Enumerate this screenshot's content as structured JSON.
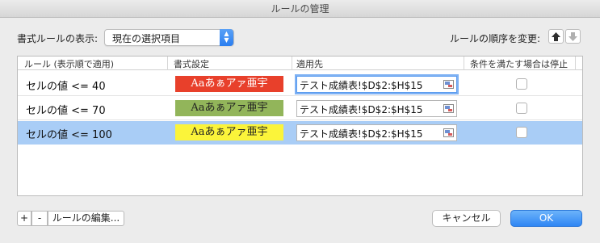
{
  "window": {
    "title": "ルールの管理"
  },
  "display": {
    "label": "書式ルールの表示:",
    "selected": "現在の選択項目"
  },
  "order": {
    "label": "ルールの順序を変更:"
  },
  "table": {
    "headers": [
      "ルール (表示順で適用)",
      "書式設定",
      "適用先",
      "条件を満たす場合は停止"
    ],
    "rows": [
      {
        "condition": "セルの値 <= 40",
        "preview": "Aaあぁアァ亜宇",
        "preview_bg": "#e8402b",
        "preview_fg": "#ffffff",
        "applies_to": "テスト成績表!$D$2:$H$15",
        "stop": false
      },
      {
        "condition": "セルの値 <= 70",
        "preview": "Aaあぁアァ亜宇",
        "preview_bg": "#92b55a",
        "preview_fg": "#222222",
        "applies_to": "テスト成績表!$D$2:$H$15",
        "stop": false
      },
      {
        "condition": "セルの値 <= 100",
        "preview": "Aaあぁアァ亜宇",
        "preview_bg": "#fbf43a",
        "preview_fg": "#222222",
        "applies_to": "テスト成績表!$D$2:$H$15",
        "stop": false
      }
    ]
  },
  "bottom": {
    "add_label": "+",
    "remove_label": "-",
    "edit_label": "ルールの編集...",
    "cancel_label": "キャンセル",
    "ok_label": "OK"
  },
  "colors": {
    "accent": "#2f86f4",
    "selection": "#a9cdf6"
  }
}
